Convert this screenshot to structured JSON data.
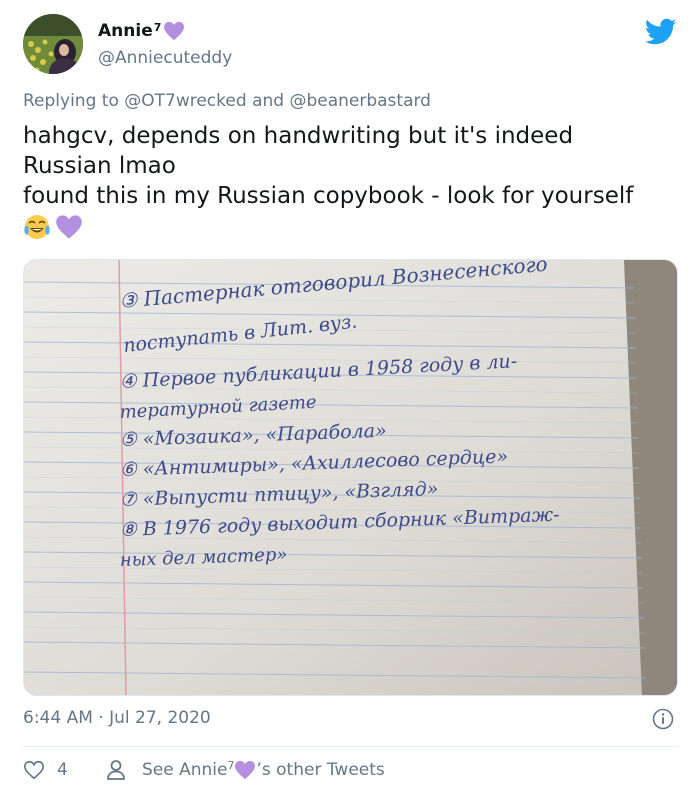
{
  "author": {
    "display_name": "Annie",
    "name_superscript": "7",
    "handle": "@Anniecuteddy",
    "name_emoji": "purple-heart-icon"
  },
  "reply": {
    "prefix": "Replying to",
    "mention_1": "@OT7wrecked",
    "joiner": "and",
    "mention_2": "@beanerbastard"
  },
  "tweet": {
    "line_1": "hahgcv, depends on handwriting but it's indeed",
    "line_2": "Russian lmao",
    "line_3": "found this in my Russian copybook - look for yourself",
    "emojis": [
      "tears-of-joy-icon",
      "purple-heart-icon"
    ]
  },
  "photo": {
    "description_icon": "copybook-photo",
    "handwritten_lines": [
      "③ Пастернак отговорил Вознесенского",
      "поступать в Лит. вуз.",
      "④ Первое публикации в 1958 году в ли-",
      "тературной газете",
      "⑤ «Мозаика», «Парабола»",
      "⑥ «Антимиры», «Ахиллесово сердце»",
      "⑦ «Выпусти птицу», «Взгляд»",
      "⑧ В 1976 году выходит сборник «Витраж-",
      "ных дел мастер»"
    ]
  },
  "meta": {
    "timestamp": "6:44 AM · Jul 27, 2020"
  },
  "footer": {
    "like_count": "4",
    "see_prefix": "See Annie",
    "see_superscript": "7",
    "see_suffix": "’s other Tweets"
  },
  "colors": {
    "twitter_blue": "#1da1f2",
    "secondary_text": "#657786",
    "purple_heart": "#b38fe0"
  }
}
